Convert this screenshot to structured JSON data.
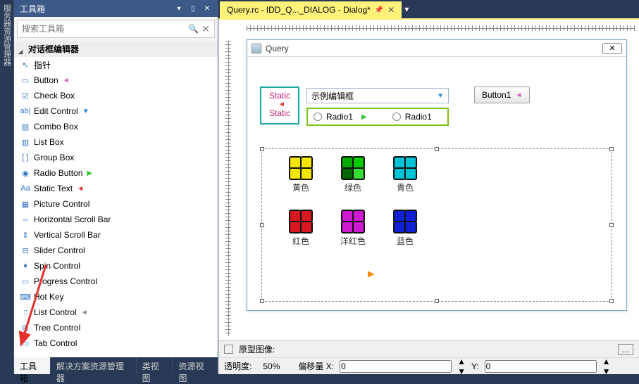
{
  "side_tab_label": "服务器资源管理器",
  "toolbox": {
    "title": "工具箱",
    "search_placeholder": "搜索工具箱",
    "category": "对话框编辑器",
    "items": [
      {
        "label": "指针",
        "marker": ""
      },
      {
        "label": "Button",
        "marker": "m-pink"
      },
      {
        "label": "Check Box",
        "marker": ""
      },
      {
        "label": "Edit Control",
        "marker": "m-blue"
      },
      {
        "label": "Combo Box",
        "marker": ""
      },
      {
        "label": "List Box",
        "marker": ""
      },
      {
        "label": "Group Box",
        "marker": ""
      },
      {
        "label": "Radio Button",
        "marker": "m-green"
      },
      {
        "label": "Static Text",
        "marker": "m-red"
      },
      {
        "label": "Picture Control",
        "marker": ""
      },
      {
        "label": "Horizontal Scroll Bar",
        "marker": ""
      },
      {
        "label": "Vertical Scroll Bar",
        "marker": ""
      },
      {
        "label": "Slider Control",
        "marker": ""
      },
      {
        "label": "Spin Control",
        "marker": ""
      },
      {
        "label": "Progress Control",
        "marker": ""
      },
      {
        "label": "Hot Key",
        "marker": ""
      },
      {
        "label": "List Control",
        "marker": "m-gray"
      },
      {
        "label": "Tree Control",
        "marker": ""
      },
      {
        "label": "Tab Control",
        "marker": ""
      }
    ],
    "icons": [
      "↖",
      "▭",
      "☑",
      "ab|",
      "▤",
      "▥",
      "[ ]",
      "◉",
      "Aa",
      "▦",
      "⇔",
      "⇕",
      "⊟",
      "♦",
      "▭",
      "⌨",
      "::",
      "⊞",
      "▭"
    ]
  },
  "bottom_tabs": [
    "工具箱",
    "解决方案资源管理器",
    "类视图",
    "资源视图"
  ],
  "doc_tab": "Query.rc - IDD_Q..._DIALOG - Dialog*",
  "dialog": {
    "title": "Query",
    "static1": "Static",
    "static2": "Static",
    "edit_value": "示例编辑框",
    "button1": "Button1",
    "radio_a": "Radio1",
    "radio_b": "Radio1",
    "colors": {
      "yellow": "黄色",
      "green": "绿色",
      "cyan": "青色",
      "red": "红色",
      "magenta": "洋红色",
      "blue": "蓝色"
    }
  },
  "status": {
    "checkbox_label": "原型图像:",
    "transparency_label": "透明度:",
    "transparency_value": "50%",
    "offset_x_label": "偏移量 X:",
    "offset_x_value": "0",
    "offset_y_label": "Y:",
    "offset_y_value": "0"
  }
}
